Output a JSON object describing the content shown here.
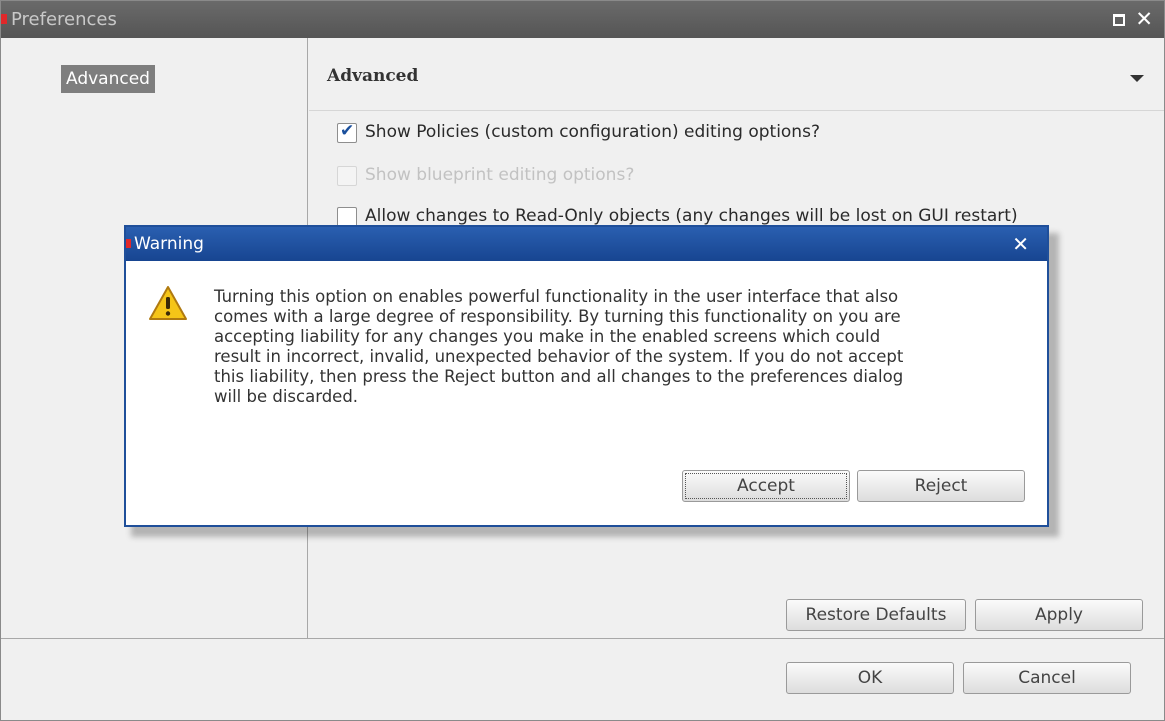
{
  "preferences": {
    "title": "Preferences",
    "sidebar": {
      "items": [
        {
          "label": "Advanced"
        }
      ]
    },
    "section_title": "Advanced",
    "options": [
      {
        "label": "Show Policies (custom configuration) editing options?",
        "checked": true,
        "enabled": true
      },
      {
        "label": "Show blueprint editing options?",
        "checked": false,
        "enabled": false
      },
      {
        "label": "Allow changes to Read-Only objects (any changes will be lost on GUI restart)",
        "checked": false,
        "enabled": true
      }
    ],
    "buttons": {
      "restore_defaults": "Restore Defaults",
      "apply": "Apply",
      "ok": "OK",
      "cancel": "Cancel"
    }
  },
  "warning": {
    "title": "Warning",
    "message_lines": [
      "Turning this option on enables powerful functionality in the user interface that also",
      "comes with a large degree of responsibility. By turning this functionality on you are",
      "accepting liability for any changes you make in the enabled screens which could",
      "result in incorrect, invalid, unexpected behavior of the system. If you do not accept",
      "this liability, then press the Reject button and all changes to the preferences dialog",
      "will be discarded."
    ],
    "buttons": {
      "accept": "Accept",
      "reject": "Reject"
    }
  },
  "colors": {
    "titlebar_gray": "#555555",
    "warning_titlebar_blue": "#1f4f9a",
    "close_dot_red": "#e0282a",
    "warning_icon_yellow": "#f5c518"
  },
  "icons": [
    "maximize-icon",
    "close-icon",
    "caret-down-icon",
    "warning-icon",
    "checkmark-icon"
  ]
}
